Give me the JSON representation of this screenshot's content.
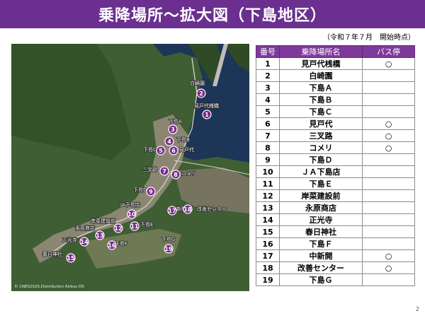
{
  "title": "乗降場所〜拡大図（下島地区）",
  "as_of": "（令和７年７月　開始時点）",
  "table": {
    "headers": [
      "番号",
      "乗降場所名",
      "バス停"
    ],
    "rows": [
      {
        "no": "1",
        "name": "見戸代桟橋",
        "bus": "○"
      },
      {
        "no": "2",
        "name": "白崎園",
        "bus": ""
      },
      {
        "no": "3",
        "name": "下島Ａ",
        "bus": ""
      },
      {
        "no": "4",
        "name": "下島Ｂ",
        "bus": ""
      },
      {
        "no": "5",
        "name": "下島Ｃ",
        "bus": ""
      },
      {
        "no": "6",
        "name": "見戸代",
        "bus": "○"
      },
      {
        "no": "7",
        "name": "三叉路",
        "bus": "○"
      },
      {
        "no": "8",
        "name": "コメリ",
        "bus": "○"
      },
      {
        "no": "9",
        "name": "下島Ｄ",
        "bus": ""
      },
      {
        "no": "10",
        "name": "ＪＡ下島店",
        "bus": ""
      },
      {
        "no": "11",
        "name": "下島Ｅ",
        "bus": ""
      },
      {
        "no": "12",
        "name": "岸菜建設前",
        "bus": ""
      },
      {
        "no": "13",
        "name": "永原商店",
        "bus": ""
      },
      {
        "no": "14",
        "name": "正光寺",
        "bus": ""
      },
      {
        "no": "15",
        "name": "春日神社",
        "bus": ""
      },
      {
        "no": "16",
        "name": "下島Ｆ",
        "bus": ""
      },
      {
        "no": "17",
        "name": "中新開",
        "bus": "○"
      },
      {
        "no": "18",
        "name": "改善センター",
        "bus": "○"
      },
      {
        "no": "19",
        "name": "下島Ｇ",
        "bus": ""
      }
    ]
  },
  "map": {
    "copyright": "© CNES2025,Distribution Airbus DS",
    "markers": [
      "1",
      "2",
      "3",
      "4",
      "5",
      "6",
      "7",
      "8",
      "9",
      "10",
      "11",
      "12",
      "13",
      "14",
      "15",
      "16",
      "17",
      "18",
      "19"
    ],
    "labels": [
      "見戸代桟橋",
      "白崎園",
      "下島A",
      "下島B",
      "下島C",
      "見戸代",
      "三叉路",
      "コメリ",
      "下島D",
      "JA下島店",
      "下島E",
      "岸菜建設前",
      "永原商店",
      "正光寺",
      "春日神社",
      "下島F",
      "中新開",
      "改善センター",
      "下島G"
    ]
  },
  "page_number": "2"
}
